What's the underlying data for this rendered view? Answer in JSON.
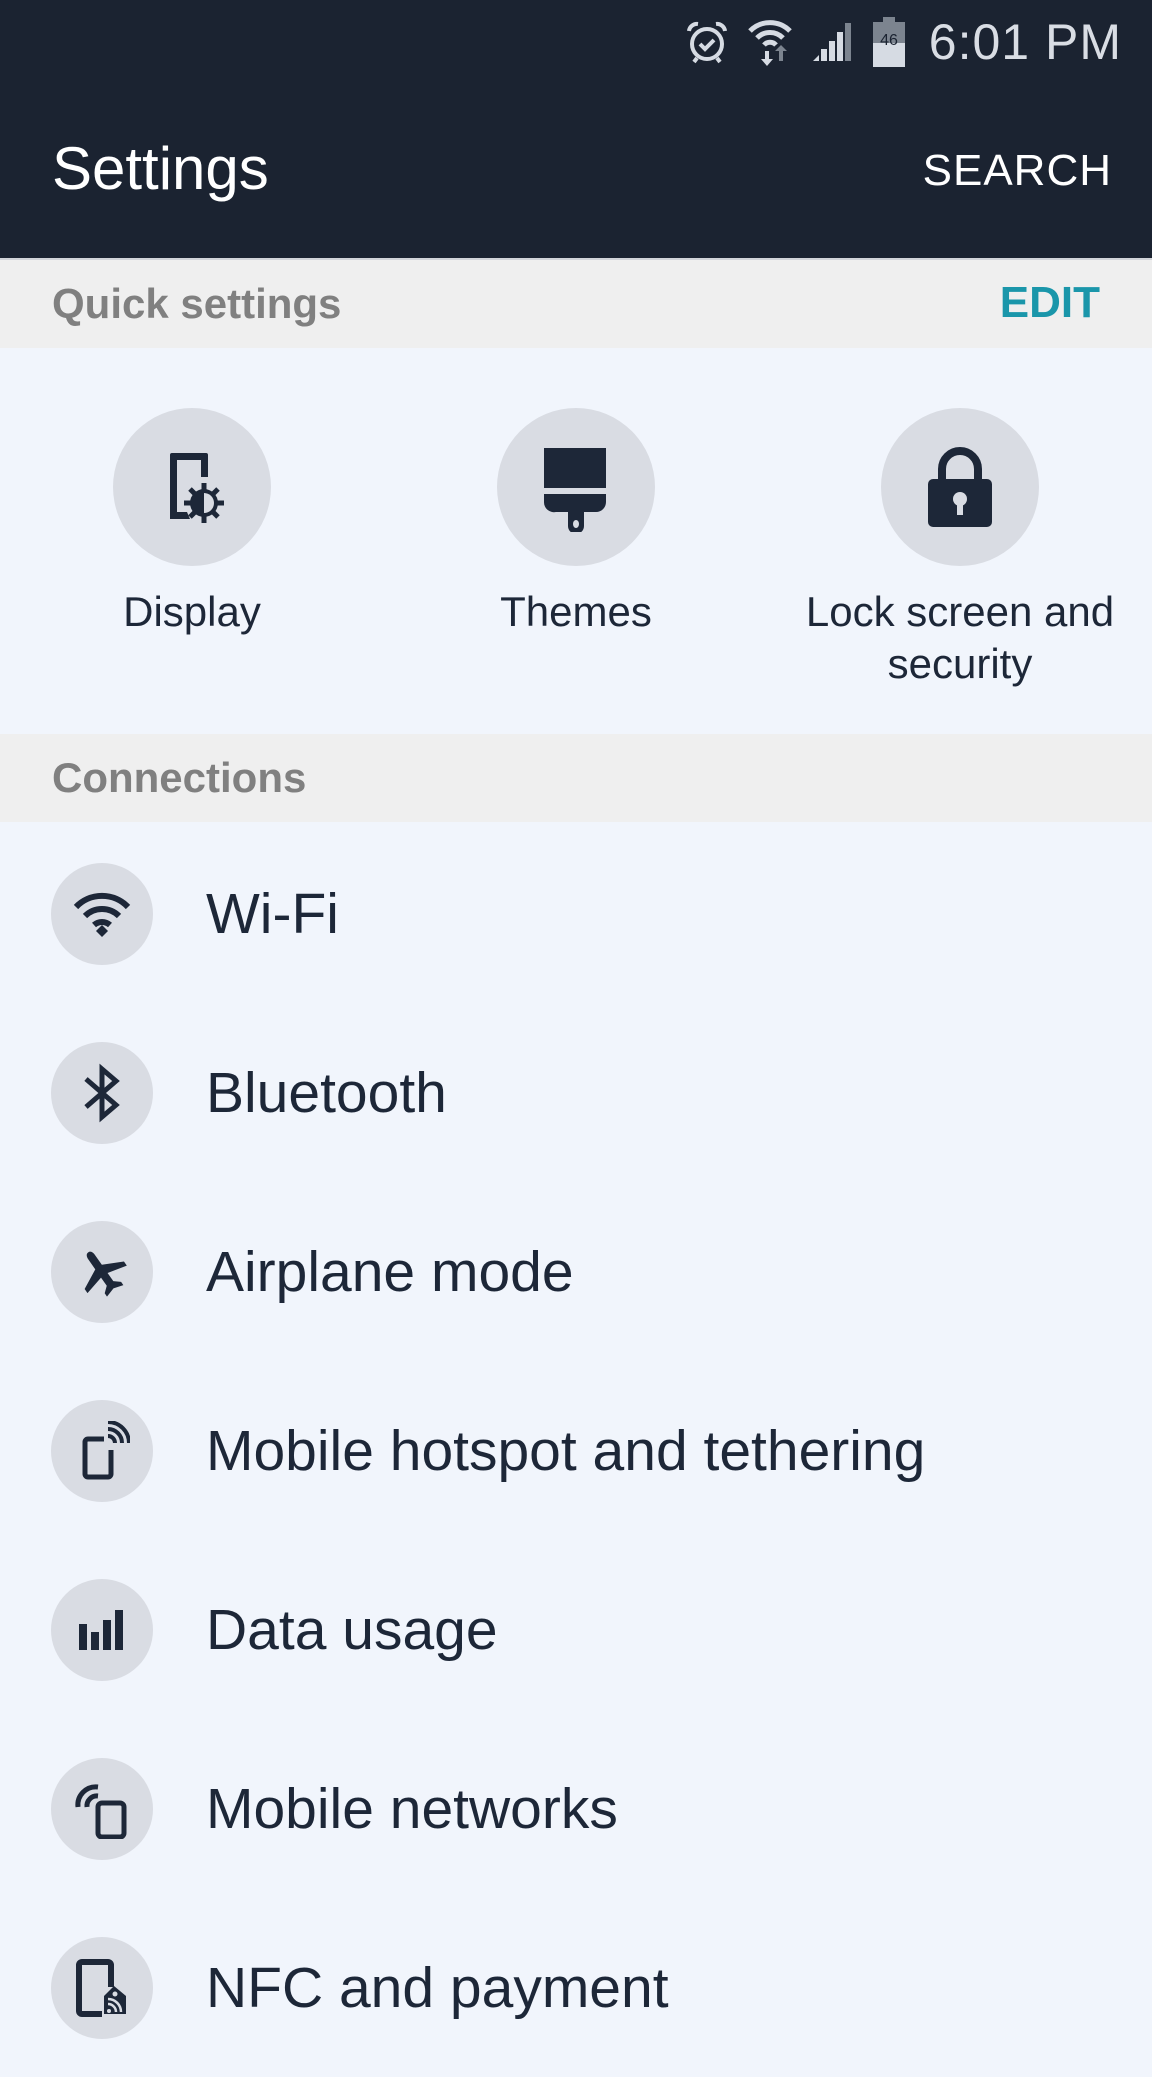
{
  "status_bar": {
    "time": "6:01 PM",
    "battery_level": "46",
    "icons": [
      "alarm-icon",
      "wifi-data-icon",
      "cellular-signal-icon",
      "battery-icon"
    ]
  },
  "header": {
    "title": "Settings",
    "search_label": "SEARCH"
  },
  "quick_settings": {
    "section_label": "Quick settings",
    "edit_label": "EDIT",
    "items": [
      {
        "label": "Display",
        "icon": "display-settings-icon"
      },
      {
        "label": "Themes",
        "icon": "paintbrush-icon"
      },
      {
        "label": "Lock screen and security",
        "icon": "lock-icon"
      }
    ]
  },
  "connections": {
    "section_label": "Connections",
    "items": [
      {
        "label": "Wi-Fi",
        "icon": "wifi-icon"
      },
      {
        "label": "Bluetooth",
        "icon": "bluetooth-icon"
      },
      {
        "label": "Airplane mode",
        "icon": "airplane-icon"
      },
      {
        "label": "Mobile hotspot and tethering",
        "icon": "hotspot-icon"
      },
      {
        "label": "Data usage",
        "icon": "data-usage-icon"
      },
      {
        "label": "Mobile networks",
        "icon": "mobile-networks-icon"
      },
      {
        "label": "NFC and payment",
        "icon": "nfc-icon"
      }
    ]
  }
}
